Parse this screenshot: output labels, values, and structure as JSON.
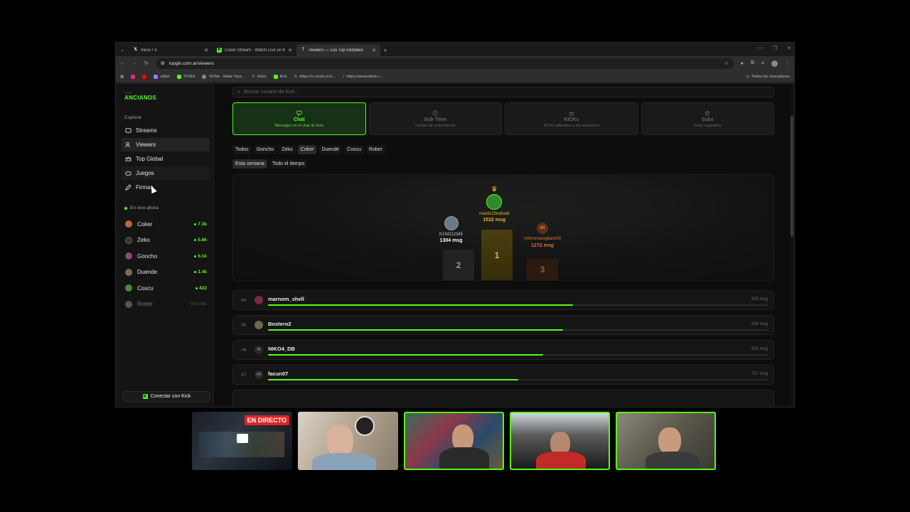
{
  "browser": {
    "tabs": [
      {
        "title": "Inicio / X",
        "icon": "x-icon",
        "active": false
      },
      {
        "title": "Coker Stream - Watch Live on Kick",
        "icon": "kick-icon",
        "active": false
      },
      {
        "title": "Viewers — Los Top Globales",
        "icon": "tg-icon",
        "active": true
      }
    ],
    "url": "topglo.com.ar/viewers",
    "bookmarks": [
      {
        "label": "",
        "color": "#e1306c"
      },
      {
        "label": "",
        "color": "#ff0000"
      },
      {
        "label": "c0ker",
        "color": "#a970ff"
      },
      {
        "label": "TOSHI",
        "color": "#53fc18"
      },
      {
        "label": "TikTok - Make Your...",
        "color": "#888888"
      },
      {
        "label": "Inicio",
        "color": "#ffffff"
      },
      {
        "label": "Kick",
        "color": "#53fc18"
      },
      {
        "label": "https://x.com/Lucst...",
        "color": "#ffffff"
      },
      {
        "label": "https://www.tiktok.c...",
        "color": "#888888"
      }
    ],
    "all_bookmarks": "Todos los marcadores"
  },
  "sidebar": {
    "brand_small": "TOP",
    "brand": "ANCIANOS",
    "section": "Explorar",
    "nav": [
      {
        "label": "Streams",
        "icon": "tv-icon"
      },
      {
        "label": "Viewers",
        "icon": "users-icon"
      },
      {
        "label": "Top Global",
        "icon": "crown-icon"
      },
      {
        "label": "Juegos",
        "icon": "gamepad-icon"
      },
      {
        "label": "Firmas",
        "icon": "pen-icon"
      }
    ],
    "live_title": "En vivo ahora",
    "streamers": [
      {
        "name": "Coker",
        "count": "7.3k",
        "color": "#c0644a"
      },
      {
        "name": "Zeko",
        "count": "5.8k",
        "color": "#333333"
      },
      {
        "name": "Goncho",
        "count": "5.1k",
        "color": "#8a4a7a"
      },
      {
        "name": "Duende",
        "count": "1.4k",
        "color": "#7a6a5a"
      },
      {
        "name": "Coscu",
        "count": "422",
        "color": "#4a8a3a"
      }
    ],
    "offline_streamer": {
      "name": "Rober",
      "status": "OFFLINE"
    },
    "connect": "Conectar con Kick"
  },
  "main": {
    "search_placeholder": "Buscar usuario de Kick...",
    "cards": [
      {
        "title": "Chat",
        "subtitle": "Mensajes en el chat de Kick",
        "icon": "chat-icon",
        "active": true
      },
      {
        "title": "Sub Time",
        "subtitle": "Tiempo de subscripción",
        "icon": "clock-icon",
        "active": false
      },
      {
        "title": "KICKs",
        "subtitle": "KICKs gifteados a los streamers",
        "icon": "gift-icon",
        "active": false
      },
      {
        "title": "Subs",
        "subtitle": "Subs regalados",
        "icon": "star-icon",
        "active": false
      }
    ],
    "filters": [
      "Todos",
      "Goncho",
      "Zeko",
      "Coker",
      "Duende",
      "Coscu",
      "Rober"
    ],
    "active_filter": "Coker",
    "periods": [
      "Esta semana",
      "Todo el tiempo"
    ],
    "active_period": "Esta semana",
    "podium": [
      {
        "place": "1",
        "name": "maxii123mdodd",
        "msg": "1532 msg"
      },
      {
        "place": "2",
        "name": "K1NG12345",
        "msg": "1304 msg"
      },
      {
        "place": "3",
        "name": "miltonmaragliano00",
        "initials": "MI",
        "msg": "1272 msg"
      }
    ],
    "ranking": [
      {
        "rank": "#4",
        "name": "marnom_shell",
        "msg": "935 msg",
        "initials": "",
        "fraction": 0.61
      },
      {
        "rank": "#5",
        "name": "Bostero2",
        "msg": "898 msg",
        "initials": "",
        "fraction": 0.59
      },
      {
        "rank": "#6",
        "name": "NIKO4_DB",
        "msg": "835 msg",
        "initials": "NI",
        "fraction": 0.55
      },
      {
        "rank": "#7",
        "name": "facun07",
        "msg": "757 msg",
        "initials": "FA",
        "fraction": 0.5
      }
    ]
  },
  "overlay": {
    "live_badge": "EN DIRECTO"
  }
}
